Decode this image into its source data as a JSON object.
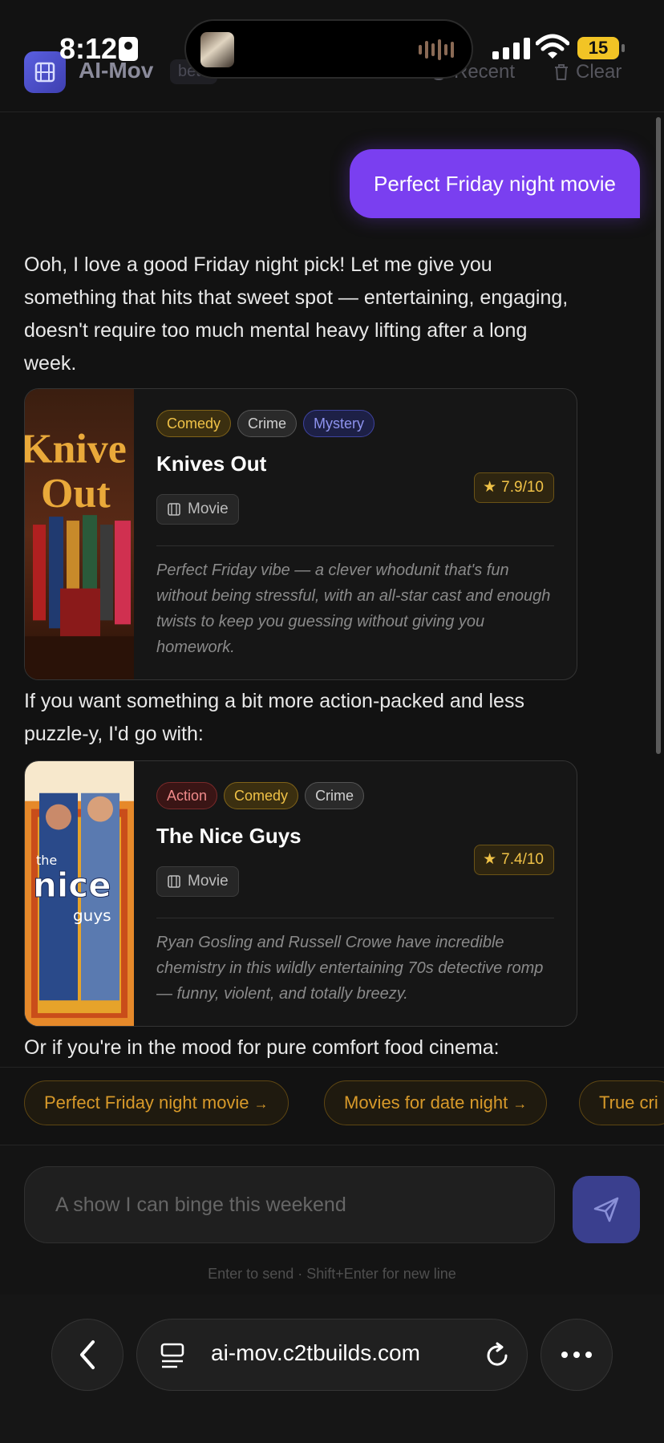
{
  "status": {
    "time": "8:12",
    "battery": "15"
  },
  "header": {
    "brand": "AI-Mov",
    "beta": "beta",
    "recent": "Recent",
    "clear": "Clear"
  },
  "chat": {
    "user_message": "Perfect Friday night movie",
    "intro": "Ooh, I love a good Friday night pick! Let me give you something that hits that sweet spot — entertaining, engaging, doesn't require too much mental heavy lifting after a long week.",
    "between": "If you want something a bit more action-packed and less puzzle-y, I'd go with:",
    "outro": "Or if you're in the mood for pure comfort food cinema:",
    "cards": [
      {
        "tags": [
          "Comedy",
          "Crime",
          "Mystery"
        ],
        "title": "Knives Out",
        "rating": "7.9/10",
        "type": "Movie",
        "blurb": "Perfect Friday vibe — a clever whodunit that's fun without being stressful, with an all-star cast and enough twists to keep you guessing without giving you homework.",
        "poster_text": "Knives Out"
      },
      {
        "tags": [
          "Action",
          "Comedy",
          "Crime"
        ],
        "title": "The Nice Guys",
        "rating": "7.4/10",
        "type": "Movie",
        "blurb": "Ryan Gosling and Russell Crowe have incredible chemistry in this wildly entertaining 70s detective romp — funny, violent, and totally breezy.",
        "poster_text": "the nice guys"
      }
    ]
  },
  "suggestions": [
    "Perfect Friday night movie",
    "Movies for date night",
    "True cri"
  ],
  "input": {
    "placeholder": "A show I can binge this weekend",
    "hint": "Enter to send · Shift+Enter for new line"
  },
  "browser": {
    "url": "ai-mov.c2tbuilds.com"
  },
  "colors": {
    "accent": "#7a3ff0",
    "gold": "#f0c247",
    "background": "#121212"
  }
}
